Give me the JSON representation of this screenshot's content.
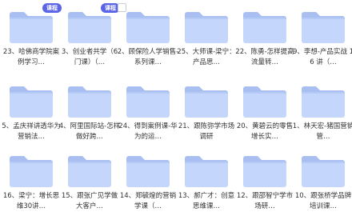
{
  "folders": [
    {
      "name": "23、哈佛商学院案例学习…",
      "badge": "课程"
    },
    {
      "name": "3、创业者共学（6门课）（…",
      "badge": "课程"
    },
    {
      "name": "2、顾保险人学销售-系列课…",
      "checkbox": true
    },
    {
      "name": "25、大师课-梁宁：产品思…"
    },
    {
      "name": "22、陈勇-怎样提高流量转…"
    },
    {
      "name": "9、李想-产品实战 16 讲（…"
    },
    {
      "name": "5、孟庆祥讲透华为营销法…"
    },
    {
      "name": "4、阿里国际站-怎样做好跨…"
    },
    {
      "name": "24、得到案例课-华为的运…"
    },
    {
      "name": "21、跟陈弥学市场调研"
    },
    {
      "name": "20、黄碧云的零售增长实…"
    },
    {
      "name": "1、林天宏-猪国营销管…"
    },
    {
      "name": "16、梁宁：增长思维30讲…"
    },
    {
      "name": "15、跟张广见学做大客户…"
    },
    {
      "name": "14、郑毓煌的营销学课（…"
    },
    {
      "name": "13、郝广才：创意思维课…"
    },
    {
      "name": "12、跟邵智宁学市场研…"
    },
    {
      "name": "10、跟张桥学品牌培训课…"
    }
  ]
}
